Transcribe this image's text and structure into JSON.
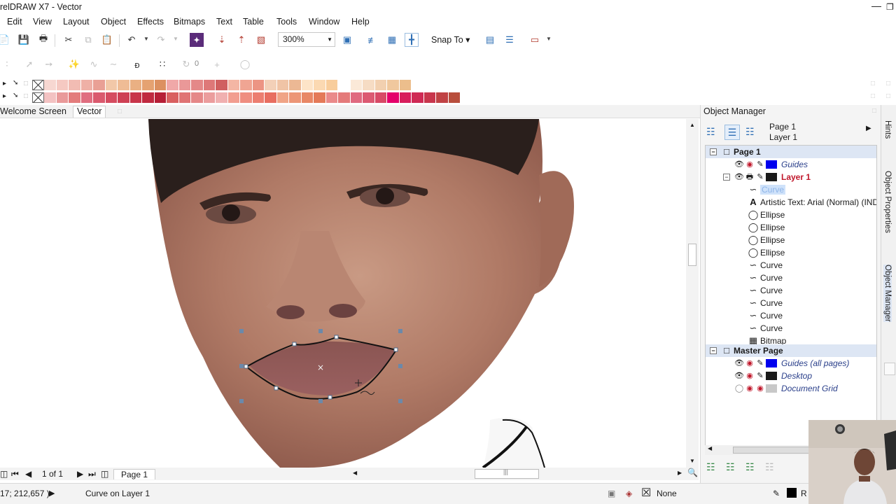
{
  "window": {
    "title": "relDRAW X7 - Vector"
  },
  "menu": [
    "Edit",
    "View",
    "Layout",
    "Object",
    "Effects",
    "Bitmaps",
    "Text",
    "Table",
    "Tools",
    "Window",
    "Help"
  ],
  "toolbar": {
    "zoom": "300%",
    "snap_to": "Snap To"
  },
  "property_bar": {
    "angle_value": "0"
  },
  "palette": {
    "row1": [
      "#f7d7d1",
      "#f5c9c2",
      "#f2bcb3",
      "#efb0a6",
      "#e9a095",
      "#f2c8a8",
      "#efbc95",
      "#eab083",
      "#e5a271",
      "#dc9060",
      "#f0a8a8",
      "#ea9898",
      "#e48888",
      "#de7878",
      "#d06060",
      "#f4b6a4",
      "#f0a593",
      "#ec9483",
      "#f3d0b8",
      "#f0c4a6",
      "#ecb894",
      "#fde4c8",
      "#fbd9b2",
      "#f8cd9c",
      "#ffffff",
      "#fbe9d8",
      "#f6dcc4",
      "#f2d0b0",
      "#f0c89e",
      "#ecbe8c"
    ],
    "row2": [
      "#f3c2c2",
      "#e99a9a",
      "#e37c7c",
      "#e06e80",
      "#da5a6e",
      "#d54c60",
      "#ce4054",
      "#c8354a",
      "#c02a40",
      "#b61f36",
      "#d96060",
      "#e07474",
      "#e58888",
      "#eb9d9d",
      "#f0b0b0",
      "#f29e90",
      "#ef8e80",
      "#ec7e70",
      "#e86e60",
      "#f0a486",
      "#ec9676",
      "#e88866",
      "#e47a58",
      "#ea8a8a",
      "#e47a7a",
      "#e06a80",
      "#dc5a72",
      "#d84a66",
      "#e4006a",
      "#d81e5c",
      "#cf2a54",
      "#c8364c",
      "#c04244",
      "#b84e3c"
    ]
  },
  "tabs": {
    "welcome": "Welcome Screen",
    "document": "Vector"
  },
  "page_nav": {
    "count": "1 of 1",
    "page_tab": "Page 1"
  },
  "status": {
    "coords": "17; 212,657 )",
    "message": "Curve on Layer 1",
    "fill_none": "None",
    "outline_partial": "R"
  },
  "docker": {
    "title": "Object Manager",
    "page_name": "Page 1",
    "layer_name": "Layer 1",
    "tree": {
      "page1": "Page 1",
      "guides": "Guides",
      "layer1": "Layer 1",
      "objects": [
        "Curve",
        "Artistic Text: Arial (Normal) (IND",
        "Ellipse",
        "Ellipse",
        "Ellipse",
        "Ellipse",
        "Curve",
        "Curve",
        "Curve",
        "Curve",
        "Curve",
        "Curve",
        "Bitmap"
      ],
      "master_page": "Master Page",
      "master_items": [
        "Guides (all pages)",
        "Desktop",
        "Document Grid"
      ]
    }
  },
  "side_tabs": [
    "Hints",
    "Object Properties",
    "Object Manager"
  ],
  "colors": {
    "guides_swatch": "#0000ee",
    "layer_swatch": "#1a1a1a",
    "layer_text": "#c0172b",
    "selection": "#cfe2fa",
    "header_band": "#dde6f4"
  }
}
